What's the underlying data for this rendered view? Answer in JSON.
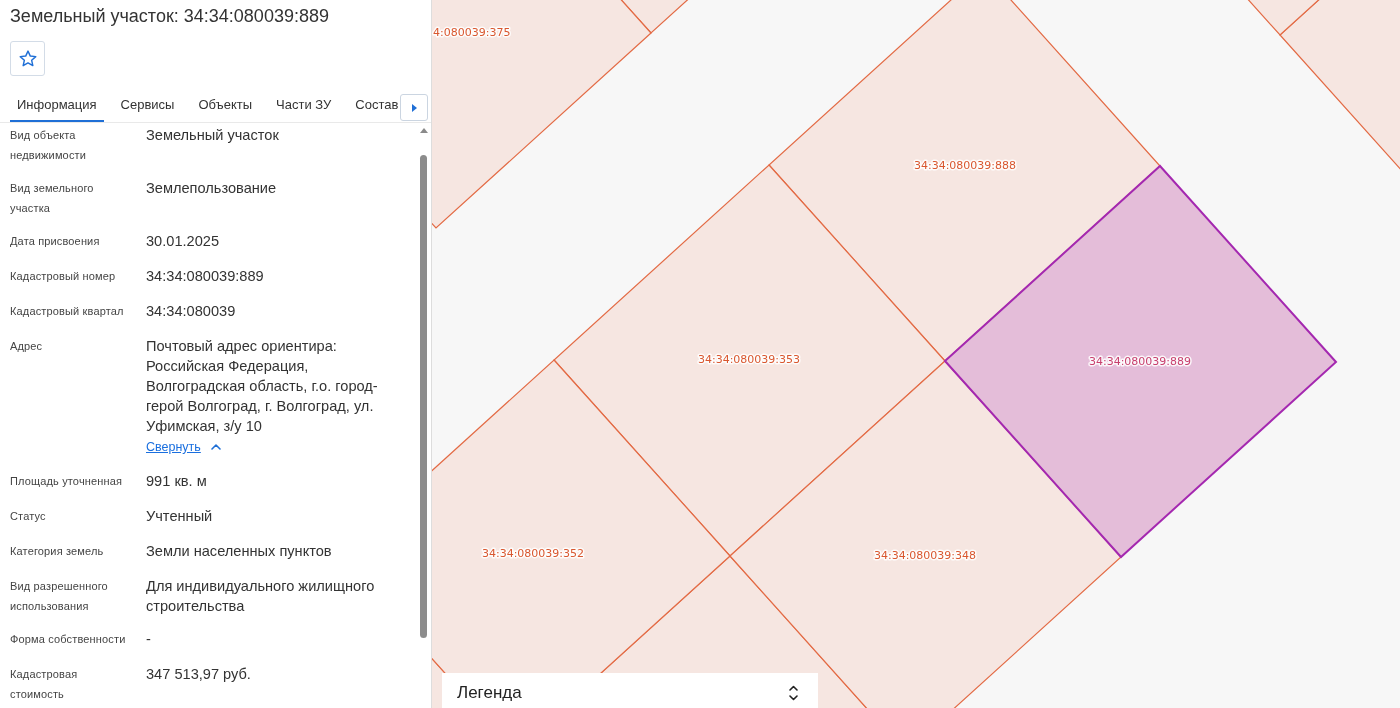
{
  "panel": {
    "title": "Земельный участок: 34:34:080039:889",
    "starred": false
  },
  "tabs": [
    {
      "label": "Информация",
      "selected": true
    },
    {
      "label": "Сервисы",
      "selected": false
    },
    {
      "label": "Объекты",
      "selected": false
    },
    {
      "label": "Части ЗУ",
      "selected": false
    },
    {
      "label": "Состав",
      "selected": false
    }
  ],
  "fields": [
    {
      "label": "Вид объекта недвижимости",
      "value": "Земельный участок"
    },
    {
      "label": "Вид земельного участка",
      "value": "Землепользование"
    },
    {
      "label": "Дата присвоения",
      "value": "30.01.2025"
    },
    {
      "label": "Кадастровый номер",
      "value": "34:34:080039:889"
    },
    {
      "label": "Кадастровый квартал",
      "value": "34:34:080039"
    },
    {
      "label": "Адрес",
      "value": "Почтовый адрес ориентира: Российская Федерация, Волгоградская область, г.о. город-герой Волгоград, г. Волгоград, ул. Уфимская, з/у 10",
      "toggle": {
        "label": "Свернуть",
        "expanded": true
      }
    },
    {
      "label": "Площадь уточненная",
      "value": "991 кв. м"
    },
    {
      "label": "Статус",
      "value": "Учтенный"
    },
    {
      "label": "Категория земель",
      "value": "Земли населенных пунктов"
    },
    {
      "label": "Вид разрешенного использования",
      "value": "Для индивидуального жилищного строительства"
    },
    {
      "label": "Форма собственности",
      "value": "-"
    },
    {
      "label": "Кадастровая стоимость",
      "value": "347 513,97 руб."
    }
  ],
  "map": {
    "parcels": [
      {
        "label": "4:080039:375",
        "selected": false
      },
      {
        "label": "34:34:080039:888",
        "selected": false
      },
      {
        "label": "34:34:080039:353",
        "selected": false
      },
      {
        "label": "34:34:080039:889",
        "selected": true
      },
      {
        "label": "34:34:080039:352",
        "selected": false
      },
      {
        "label": "34:34:080039:348",
        "selected": false
      }
    ],
    "legend": {
      "title": "Легенда"
    }
  }
}
